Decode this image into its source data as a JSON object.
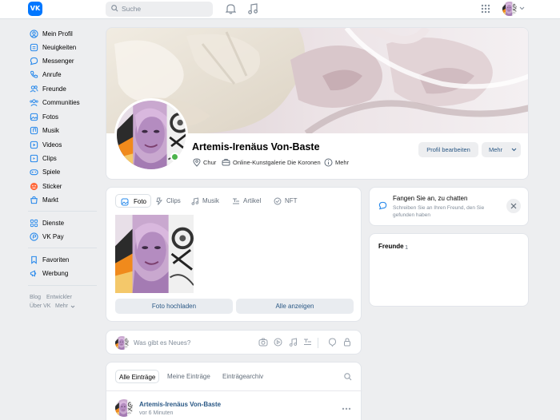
{
  "topbar": {
    "logo": "VK",
    "search_placeholder": "Suche",
    "icons": [
      "search-icon",
      "bell-icon",
      "music-icon",
      "apps-grid-icon",
      "chevron-down-icon"
    ]
  },
  "sidebar": {
    "items": [
      {
        "label": "Mein Profil",
        "icon": "user-circle-icon"
      },
      {
        "label": "Neuigkeiten",
        "icon": "newspaper-icon"
      },
      {
        "label": "Messenger",
        "icon": "message-icon"
      },
      {
        "label": "Anrufe",
        "icon": "phone-icon"
      },
      {
        "label": "Freunde",
        "icon": "friends-icon"
      },
      {
        "label": "Communities",
        "icon": "communities-icon"
      },
      {
        "label": "Fotos",
        "icon": "photo-icon"
      },
      {
        "label": "Musik",
        "icon": "music-icon"
      },
      {
        "label": "Videos",
        "icon": "video-icon"
      },
      {
        "label": "Clips",
        "icon": "clips-icon"
      },
      {
        "label": "Spiele",
        "icon": "games-icon"
      },
      {
        "label": "Sticker",
        "icon": "sticker-icon"
      },
      {
        "label": "Markt",
        "icon": "market-icon"
      }
    ],
    "items2": [
      {
        "label": "Dienste",
        "icon": "services-icon"
      },
      {
        "label": "VK Pay",
        "icon": "vkpay-icon"
      }
    ],
    "items3": [
      {
        "label": "Favoriten",
        "icon": "bookmark-icon"
      },
      {
        "label": "Werbung",
        "icon": "ads-icon"
      }
    ],
    "footer": {
      "blog": "Blog",
      "dev": "Entwickler",
      "about": "Über VK",
      "more": "Mehr"
    }
  },
  "profile": {
    "name": "Artemis-Irenäus Von-Baste",
    "city": "Chur",
    "work": "Online-Kunstgalerie Die Koronen",
    "more_info": "Mehr",
    "edit_button": "Profil bearbeiten",
    "more_button": "Mehr",
    "online": true
  },
  "media": {
    "tabs": [
      "Foto",
      "Clips",
      "Musik",
      "Artikel",
      "NFT"
    ],
    "upload_button": "Foto hochladen",
    "show_all_button": "Alle anzeigen"
  },
  "chat_banner": {
    "title": "Fangen Sie an, zu chatten",
    "subtitle": "Schreiben Sie an Ihren Freund, den Sie gefunden haben"
  },
  "friends": {
    "title": "Freunde",
    "count": "1"
  },
  "composer": {
    "placeholder": "Was gibt es Neues?"
  },
  "feed": {
    "tabs": [
      "Alle Einträge",
      "Meine Einträge",
      "Einträgearchiv"
    ],
    "post": {
      "author": "Artemis-Irenäus Von-Baste",
      "time": "vor 6 Minuten"
    }
  },
  "colors": {
    "accent": "#0077ff",
    "link": "#2a5885",
    "online": "#4bb34b",
    "background": "#edeef0"
  }
}
